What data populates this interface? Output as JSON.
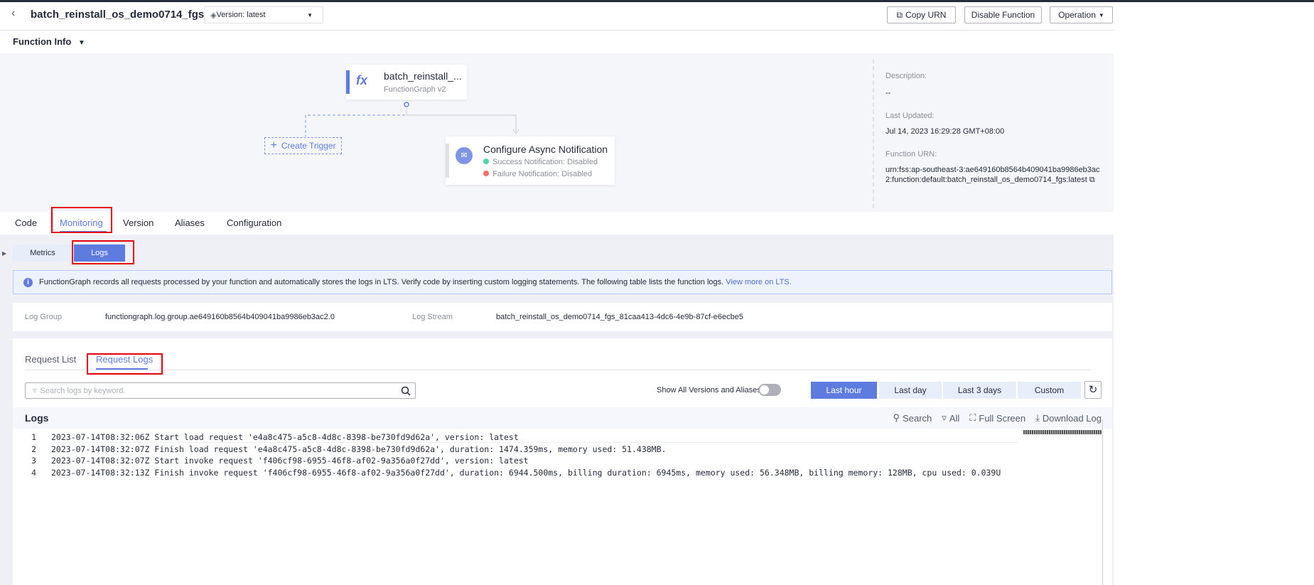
{
  "header": {
    "title": "batch_reinstall_os_demo0714_fgs",
    "version": "Version: latest",
    "copy_urn": "Copy URN",
    "disable": "Disable Function",
    "operation": "Operation"
  },
  "function_info": {
    "label": "Function Info",
    "node_name": "batch_reinstall_...",
    "node_sub": "FunctionGraph v2",
    "create_trigger": "Create Trigger",
    "async_title": "Configure Async Notification",
    "success": "Success Notification: Disabled",
    "failure": "Failure Notification: Disabled",
    "description_label": "Description:",
    "description": "--",
    "updated_label": "Last Updated:",
    "updated": "Jul 14, 2023 16:29:28 GMT+08:00",
    "urn_label": "Function URN:",
    "urn": "urn:fss:ap-southeast-3:ae649160b8564b409041ba9986eb3ac2:function:default:batch_reinstall_os_demo0714_fgs:latest"
  },
  "tabs": [
    "Code",
    "Monitoring",
    "Version",
    "Aliases",
    "Configuration"
  ],
  "subtabs": [
    "Metrics",
    "Logs"
  ],
  "banner": {
    "text": "FunctionGraph records all requests processed by your function and automatically stores the logs in LTS. Verify code by inserting custom logging statements. The following table lists the function logs.",
    "link": "View more on LTS."
  },
  "log_info": {
    "group_label": "Log Group",
    "group": "functiongraph.log.group.ae649160b8564b409041ba9986eb3ac2.0",
    "stream_label": "Log Stream",
    "stream": "batch_reinstall_os_demo0714_fgs_81caa413-4dc6-4e9b-87cf-e6ecbe5"
  },
  "request_tabs": [
    "Request List",
    "Request Logs"
  ],
  "search_placeholder": "Search logs by keyword.",
  "show_all": "Show All Versions and Aliases",
  "time_ranges": [
    "Last hour",
    "Last day",
    "Last 3 days",
    "Custom"
  ],
  "logs": {
    "title": "Logs",
    "search": "Search",
    "all": "All",
    "fullscreen": "Full Screen",
    "download": "Download Log",
    "lines": [
      {
        "n": "1",
        "t": "2023-07-14T08:32:06Z Start load request 'e4a8c475-a5c8-4d8c-8398-be730fd9d62a', version: latest"
      },
      {
        "n": "2",
        "t": "2023-07-14T08:32:07Z Finish load request 'e4a8c475-a5c8-4d8c-8398-be730fd9d62a', duration: 1474.359ms, memory used: 51.438MB."
      },
      {
        "n": "3",
        "t": "2023-07-14T08:32:07Z Start invoke request 'f406cf98-6955-46f8-af02-9a356a0f27dd', version: latest"
      },
      {
        "n": "4",
        "t": "2023-07-14T08:32:13Z Finish invoke request 'f406cf98-6955-46f8-af02-9a356a0f27dd', duration: 6944.500ms, billing duration: 6945ms, memory used: 56.348MB, billing memory: 128MB, cpu used: 0.039U"
      }
    ]
  },
  "colors": {
    "accent": "#5e7ce0",
    "highlight": "#e6000e",
    "success": "#50d4ab",
    "failure": "#f66f6a"
  }
}
